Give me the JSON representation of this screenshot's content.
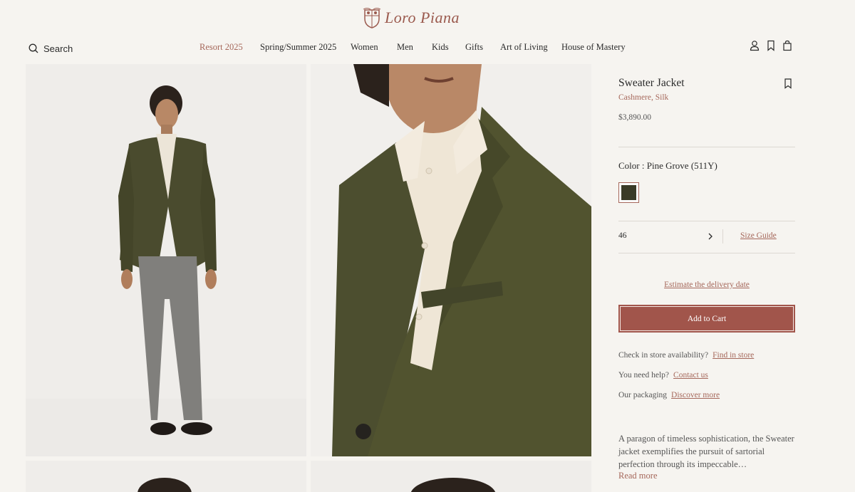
{
  "brand": {
    "name": "Loro Piana"
  },
  "header": {
    "search_label": "Search",
    "nav": [
      {
        "label": "Resort 2025",
        "active": true
      },
      {
        "label": "Spring/Summer 2025",
        "active": false
      },
      {
        "label": "Women",
        "active": false
      },
      {
        "label": "Men",
        "active": false
      },
      {
        "label": "Kids",
        "active": false
      },
      {
        "label": "Gifts",
        "active": false
      },
      {
        "label": "Art of Living",
        "active": false
      },
      {
        "label": "House of Mastery",
        "active": false
      }
    ],
    "icons": [
      "account-icon",
      "wishlist-icon",
      "shopping-bag-icon"
    ]
  },
  "gallery": {
    "images": [
      "full-length-model-photo",
      "jacket-detail-closeup-photo",
      "model-photo-row-2-left",
      "model-photo-row-2-right"
    ]
  },
  "product": {
    "title": "Sweater Jacket",
    "material": "Cashmere, Silk",
    "price": "$3,890.00",
    "color_label": "Color : Pine Grove (511Y)",
    "color_hex": "#3a3b27",
    "size_value": "46",
    "size_guide_label": "Size Guide",
    "delivery_label": "Estimate the delivery date",
    "add_to_cart_label": "Add to Cart",
    "store_question": "Check in store availability?",
    "store_link": "Find in store",
    "help_question": "You need help?",
    "help_link": "Contact us",
    "packaging_question": "Our packaging",
    "packaging_link": "Discover more",
    "description": "A paragon of timeless sophistication, the Sweater jacket exemplifies the pursuit of sartorial perfection through its impeccable…",
    "read_more_label": "Read more"
  },
  "colors": {
    "accent": "#a5675a",
    "button": "#a1554b",
    "background": "#f6f4f0"
  }
}
